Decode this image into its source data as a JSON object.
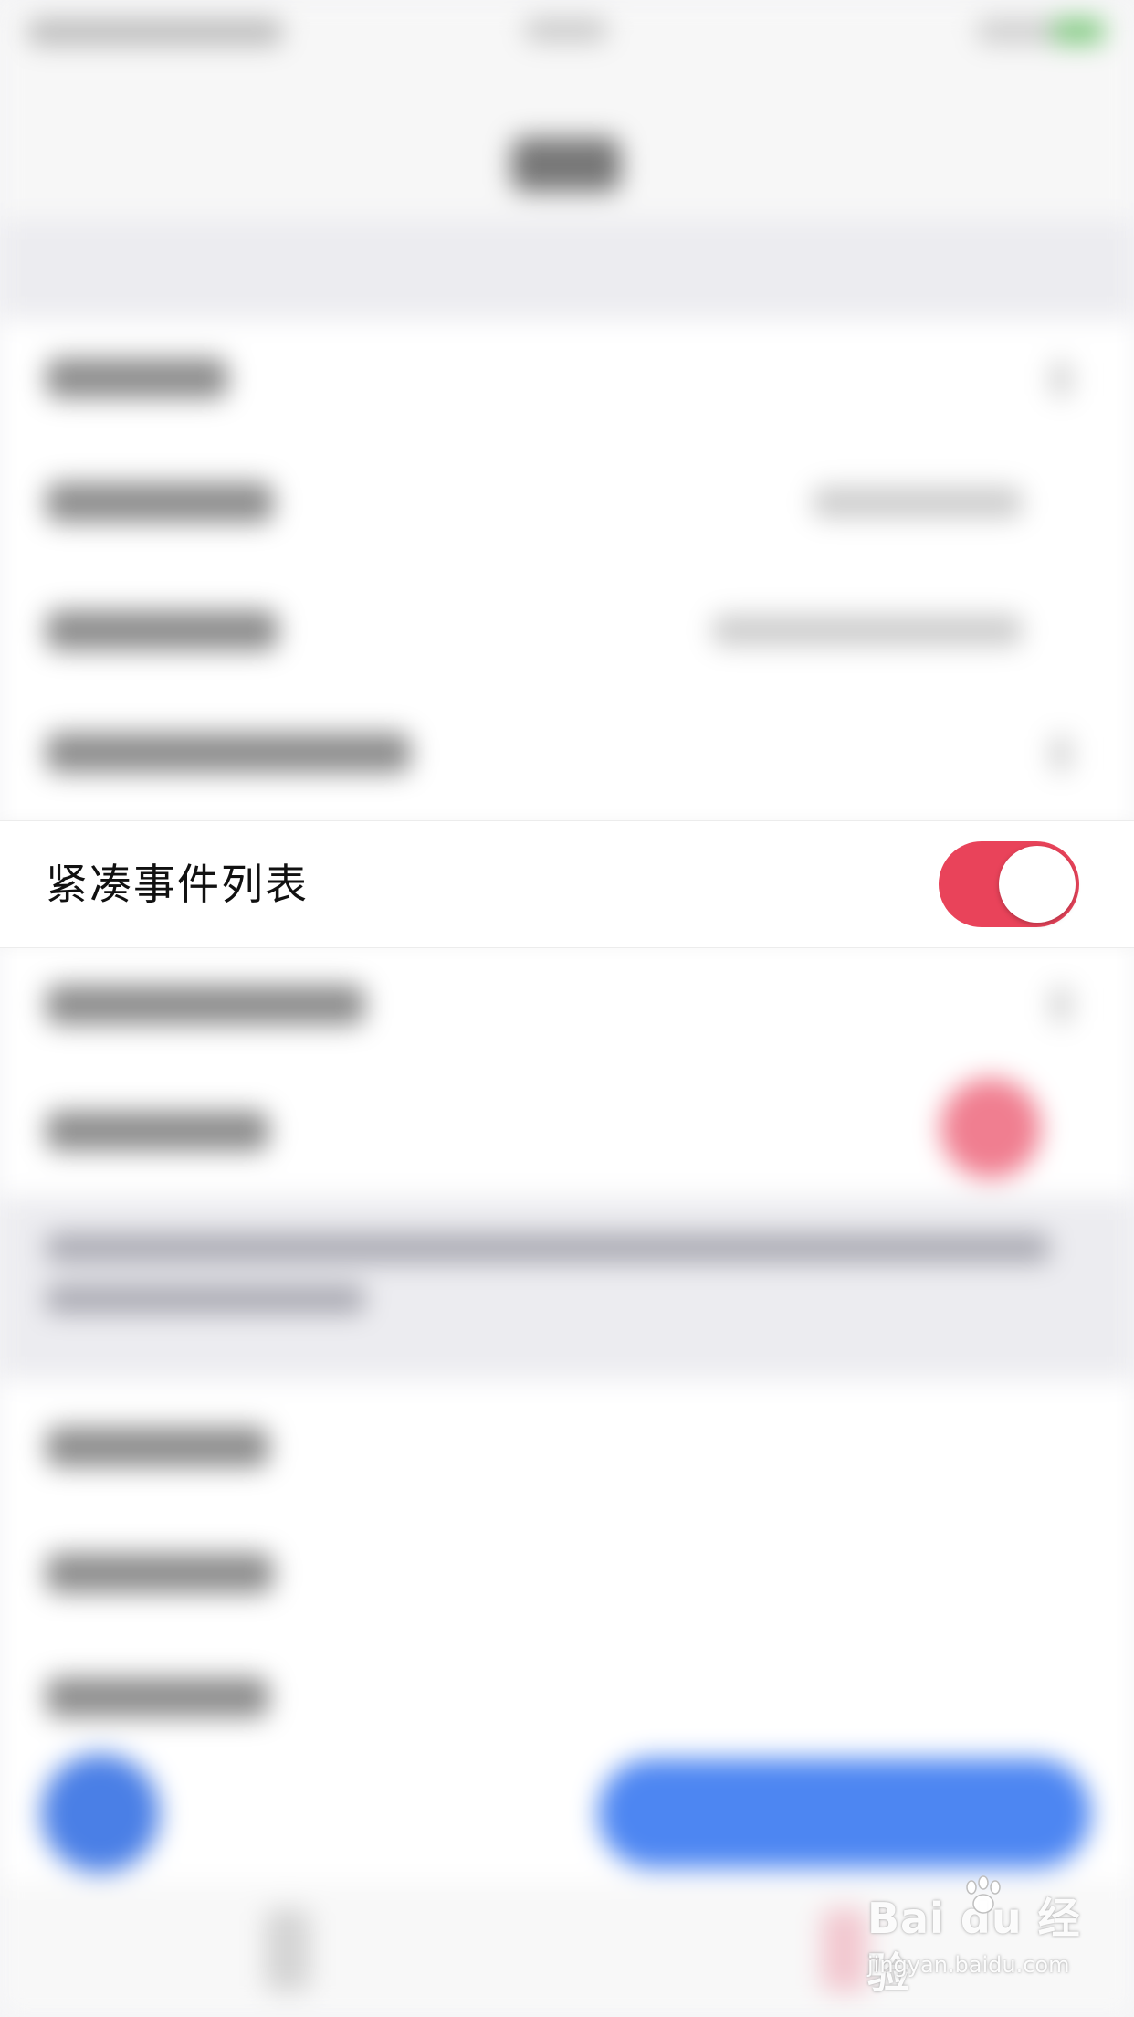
{
  "settings": {
    "compact_event_list_label": "紧凑事件列表",
    "compact_event_list_enabled": true
  },
  "watermark": {
    "logo_text": "Bai du 经验",
    "url": "jingyan.baidu.com"
  },
  "colors": {
    "toggle_on": "#e9435a",
    "accent_blue": "#4d86f2",
    "background": "#f4f4f6"
  }
}
